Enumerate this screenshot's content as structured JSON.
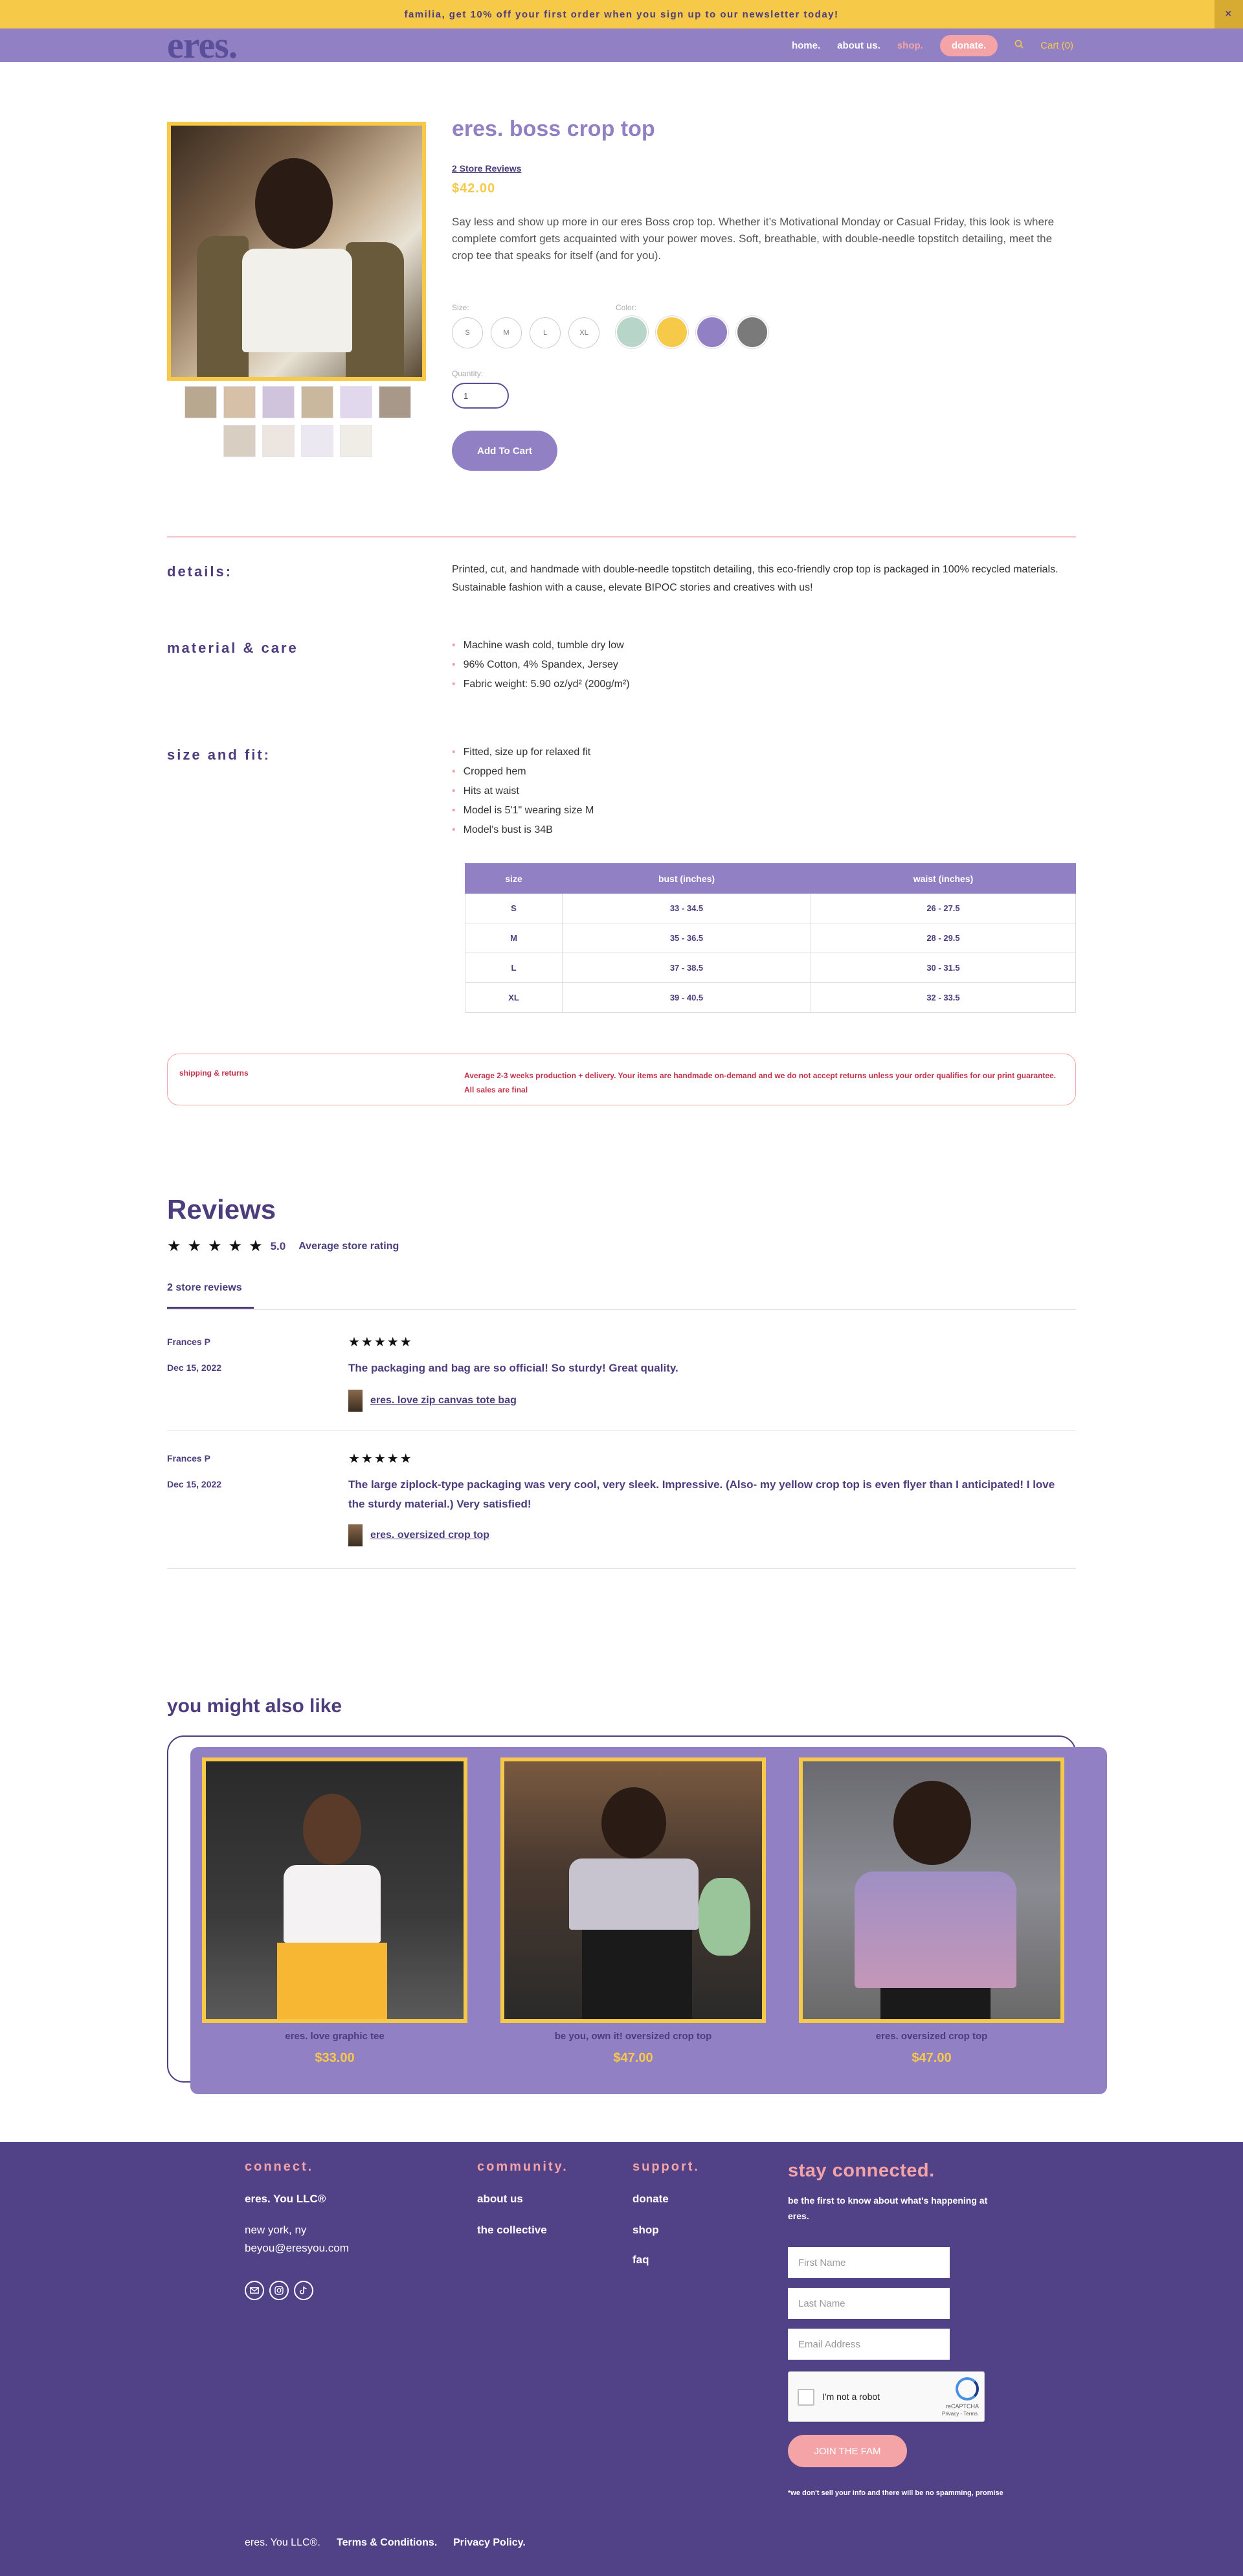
{
  "announcement": {
    "text": "familia, get 10% off your first order when you sign up to our newsletter today!",
    "close": "×"
  },
  "nav": {
    "logo": "eres.",
    "links": [
      "home.",
      "about us.",
      "shop.",
      "donate."
    ],
    "search_icon": "search-icon",
    "cart": "Cart (0)"
  },
  "product": {
    "title": "eres. boss crop top",
    "reviews_link": "2 Store Reviews",
    "price": "$42.00",
    "description": "Say less and show up more in our eres Boss crop top. Whether it’s Motivational Monday or Casual Friday, this look is where complete comfort gets acquainted with your power moves. Soft, breathable, with double-needle topstitch detailing, meet the crop tee that speaks for itself (and for you).",
    "size_label": "Size:",
    "sizes": [
      "S",
      "M",
      "L",
      "XL"
    ],
    "color_label": "Color:",
    "colors": [
      "#b7d6c9",
      "#f7c948",
      "#9180c4",
      "#7a7a7a"
    ],
    "quantity_label": "Quantity:",
    "quantity": "1",
    "add_to_cart": "Add To Cart"
  },
  "details": {
    "label": "details:",
    "text": "Printed, cut, and handmade with double-needle topstitch detailing, this eco-friendly crop top is packaged in 100% recycled materials. Sustainable fashion with a cause, elevate BIPOC stories and creatives with us!"
  },
  "material": {
    "label": "material & care",
    "items": [
      "Machine wash cold, tumble dry low",
      "96% Cotton, 4% Spandex, Jersey",
      "Fabric weight: 5.90 oz/yd² (200g/m²)"
    ]
  },
  "size_fit": {
    "label": "size and fit:",
    "items": [
      "Fitted, size up for relaxed fit",
      "Cropped hem",
      "Hits at waist",
      "Model is 5'1\" wearing size M",
      "Model's bust is 34B"
    ],
    "table": {
      "headers": [
        "size",
        "bust (inches)",
        "waist (inches)"
      ],
      "rows": [
        [
          "S",
          "33 - 34.5",
          "26 - 27.5"
        ],
        [
          "M",
          "35 - 36.5",
          "28 - 29.5"
        ],
        [
          "L",
          "37 - 38.5",
          "30 - 31.5"
        ],
        [
          "XL",
          "39 - 40.5",
          "32 - 33.5"
        ]
      ]
    }
  },
  "shipping": {
    "label": "shipping & returns",
    "text": "Average 2-3 weeks production + delivery. Your items are handmade on-demand and we do not accept returns unless your order qualifies for our print guarantee. All sales are final"
  },
  "reviews": {
    "heading": "Reviews",
    "rating": "5.0",
    "rating_label": "Average store rating",
    "tab": "2 store reviews",
    "items": [
      {
        "author": "Frances P",
        "date": "Dec 15, 2022",
        "stars": "★★★★★",
        "body": "The packaging and bag are so official! So sturdy! Great quality.",
        "product": "eres. love zip canvas tote bag"
      },
      {
        "author": "Frances P",
        "date": "Dec 15, 2022",
        "stars": "★★★★★",
        "body": "The large ziplock-type packaging was very cool, very sleek. Impressive. (Also- my yellow crop top is even flyer than I anticipated! I love the sturdy material.) Very satisfied!",
        "product": "eres. oversized crop top"
      }
    ]
  },
  "also_like": {
    "heading": "you might also like",
    "items": [
      {
        "name": "eres. love graphic tee",
        "price": "$33.00"
      },
      {
        "name": "be you, own it! oversized crop top",
        "price": "$47.00"
      },
      {
        "name": "eres. oversized crop top",
        "price": "$47.00"
      }
    ]
  },
  "footer": {
    "connect_h": "connect.",
    "company": "eres. You LLC®",
    "location": "new york, ny",
    "email": "beyou@eresyou.com",
    "social_icons": [
      "email-icon",
      "instagram-icon",
      "tiktok-icon"
    ],
    "community_h": "community.",
    "community": [
      "about us",
      "the collective"
    ],
    "support_h": "support.",
    "support": [
      "donate",
      "shop",
      "faq"
    ],
    "stay_h": "stay connected.",
    "stay_sub": "be the first to know about what's happening at eres.",
    "first_name": "First Name",
    "last_name": "Last Name",
    "email_ph": "Email Address",
    "captcha_text": "I'm not a robot",
    "captcha_brand": "reCAPTCHA",
    "captcha_links": "Privacy - Terms",
    "join": "JOIN THE FAM",
    "disclaimer": "*we don't sell your info and there will be no spamming, promise",
    "bottom_company": "eres. You LLC®.",
    "terms": "Terms & Conditions.",
    "privacy": "Privacy Policy."
  }
}
